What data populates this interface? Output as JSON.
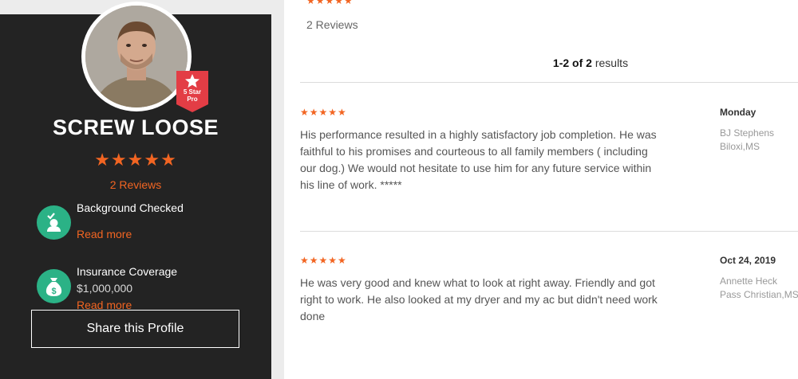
{
  "profile": {
    "name": "SCREW LOOSE",
    "stars": "★★★★★",
    "reviews_link": "2 Reviews",
    "badge": {
      "line1": "5 Star",
      "line2": "Pro",
      "color": "#e33d45"
    },
    "features": [
      {
        "icon": "background-check-icon",
        "title": "Background Checked",
        "link": "Read more"
      },
      {
        "icon": "money-bag-icon",
        "title": "Insurance Coverage",
        "value": "$1,000,000",
        "link": "Read more"
      }
    ],
    "share_label": "Share this Profile"
  },
  "reviews_header": {
    "stars": "★★★★★",
    "count": "2 Reviews",
    "results_range": "1-2 of 2",
    "results_suffix": "results"
  },
  "reviews": [
    {
      "stars": "★★★★★",
      "text": "His performance resulted in a highly satisfactory job completion. He was faithful to his promises and courteous to all family members ( including our dog.) We would not hesitate to use him for any future service within his line of work. *****",
      "date": "Monday",
      "author": "BJ Stephens",
      "location": "Biloxi,MS"
    },
    {
      "stars": "★★★★★",
      "text": "He was very good and knew what to look at right away. Friendly and got right to work. He also looked at my dryer and my ac but didn't need work done",
      "date": "Oct 24, 2019",
      "author": "Annette Heck",
      "location": "Pass Christian,MS"
    }
  ],
  "colors": {
    "accent": "#f26522",
    "sidebar": "#232323",
    "feature_icon_bg": "#2bb286"
  }
}
